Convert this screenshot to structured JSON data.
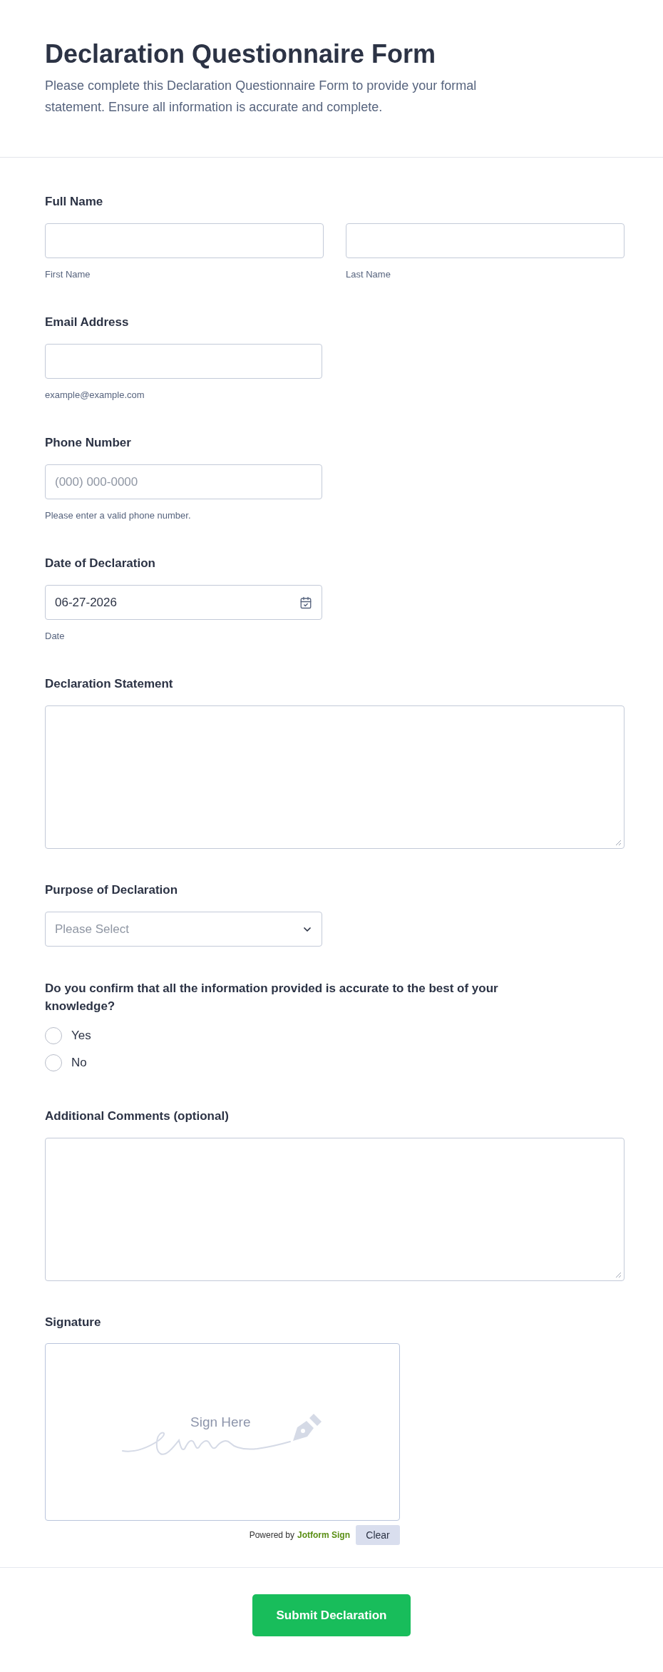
{
  "header": {
    "title": "Declaration Questionnaire Form",
    "description": "Please complete this Declaration Questionnaire Form to provide your formal statement. Ensure all information is accurate and complete."
  },
  "fields": [
    {
      "kind": "name",
      "label": "Full Name",
      "inputs": [
        {
          "sublabel": "First Name"
        },
        {
          "sublabel": "Last Name"
        }
      ]
    },
    {
      "kind": "text",
      "label": "Email Address",
      "sublabel": "example@example.com"
    },
    {
      "kind": "text",
      "label": "Phone Number",
      "placeholder": "(000) 000-0000",
      "sublabel": "Please enter a valid phone number."
    },
    {
      "kind": "date",
      "label": "Date of Declaration",
      "value": "06-27-2026",
      "sublabel": "Date"
    },
    {
      "kind": "textarea",
      "label": "Declaration Statement"
    },
    {
      "kind": "select",
      "label": "Purpose of Declaration",
      "placeholder": "Please Select"
    },
    {
      "kind": "radio",
      "label": "Do you confirm that all the information provided is accurate to the best of your knowledge?",
      "options": [
        {
          "label": "Yes",
          "selected": false
        },
        {
          "label": "No",
          "selected": false
        }
      ]
    },
    {
      "kind": "textarea",
      "label": "Additional Comments (optional)"
    },
    {
      "kind": "signature",
      "label": "Signature",
      "prompt": "Sign Here",
      "powered_by": "Powered by",
      "brand_link": "Jotform Sign",
      "clear_button": "Clear"
    }
  ],
  "submit_button": "Submit Declaration"
}
